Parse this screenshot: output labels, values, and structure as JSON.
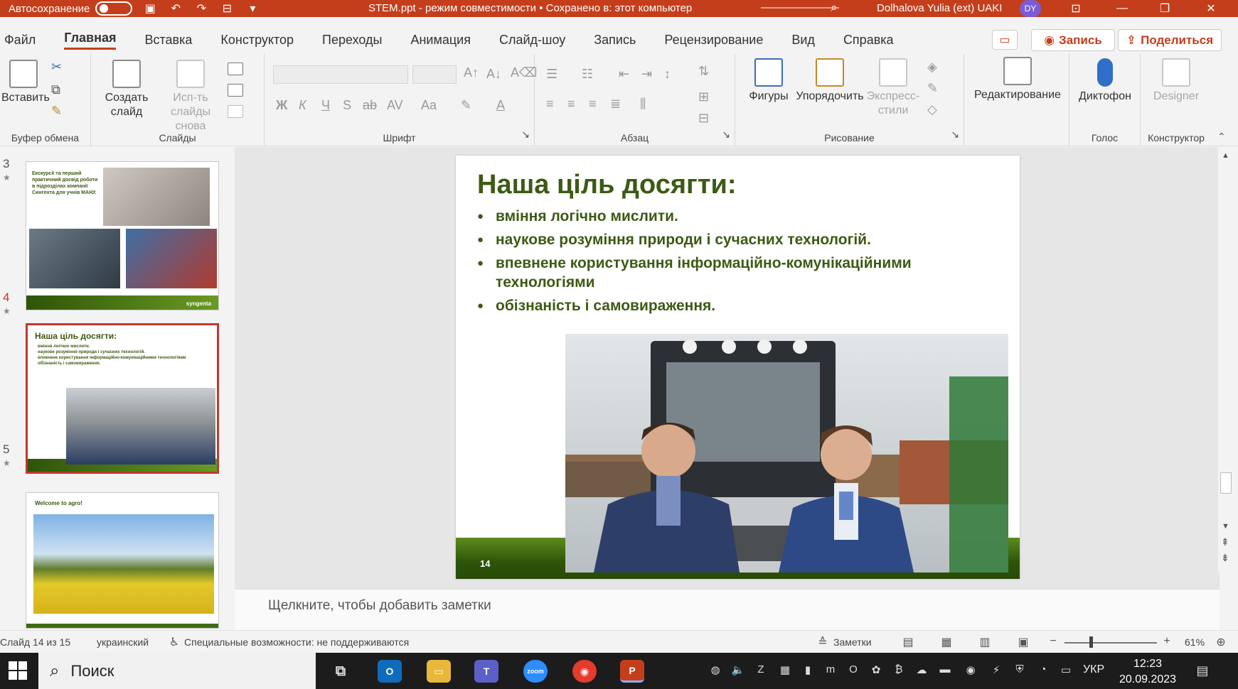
{
  "titlebar": {
    "autosave_label": "Автосохранение",
    "document_title": "STEM.ppt  -  режим совместимости • Сохранено в: этот компьютер",
    "user_name": "Dolhalova Yulia (ext) UAKI",
    "user_initials": "DY",
    "accent_color": "#c43e1c"
  },
  "menu": {
    "items": [
      "Файл",
      "Главная",
      "Вставка",
      "Конструктор",
      "Переходы",
      "Анимация",
      "Слайд-шоу",
      "Запись",
      "Рецензирование",
      "Вид",
      "Справка"
    ],
    "active": "Главная",
    "record_label": "Запись",
    "share_label": "Поделиться"
  },
  "ribbon": {
    "clipboard": {
      "paste_label": "Вставить",
      "group_label": "Буфер обмена"
    },
    "slides": {
      "new_slide_label_1": "Создать",
      "new_slide_label_2": "слайд",
      "reuse_label_1": "Исп-ть",
      "reuse_label_2": "слайды снова",
      "group_label": "Слайды"
    },
    "font": {
      "group_label": "Шрифт",
      "bold": "Ж",
      "italic": "К",
      "underline": "Ч",
      "shadow": "S",
      "strike": "ab",
      "spacing": "AV",
      "case": "Aa",
      "font_color": "A"
    },
    "paragraph": {
      "group_label": "Абзац"
    },
    "drawing": {
      "shapes_label": "Фигуры",
      "arrange_label": "Упорядочить",
      "quick_styles_label_1": "Экспресс-",
      "quick_styles_label_2": "стили",
      "group_label": "Рисование"
    },
    "editing": {
      "label": "Редактирование"
    },
    "voice": {
      "dictate_label": "Диктофон",
      "group_label": "Голос"
    },
    "designer": {
      "label": "Designer",
      "group_label": "Конструктор"
    }
  },
  "thumbnails": [
    {
      "number": "3",
      "title": "Екскурсії та перший практичний досвід роботи в підрозділах компанії Сингента для учнів МАНУ.",
      "brand": "syngenta"
    },
    {
      "number": "4",
      "title": "Наша ціль досягти:",
      "bullets": [
        "вміння логічно  мислити.",
        "наукове розуміння природи і сучасних технологій.",
        "впевнене користування інформаційно-комунікаційними технологіями",
        "обізнаність і самовираження."
      ],
      "selected": true
    },
    {
      "number": "5",
      "title": "Welcome to agro!"
    }
  ],
  "slide": {
    "title": "Наша ціль досягти:",
    "bullets": [
      "вміння логічно  мислити.",
      "наукове розуміння природи і сучасних технологій.",
      "впевнене користування інформаційно-комунікаційними технологіями",
      "обізнаність і самовираження."
    ],
    "slide_number": "14",
    "title_color": "#3d5a14"
  },
  "notes": {
    "placeholder": "Щелкните, чтобы добавить заметки"
  },
  "status": {
    "slide_info": "Слайд 14 из 15",
    "language": "украинский",
    "accessibility": "Специальные возможности: не поддерживаются",
    "notes_label": "Заметки",
    "zoom": "61%"
  },
  "taskbar": {
    "search_placeholder": "Поиск",
    "zoom_app_label": "zoom",
    "keyboard_layout": "УКР",
    "time": "12:23",
    "date": "20.09.2023"
  }
}
